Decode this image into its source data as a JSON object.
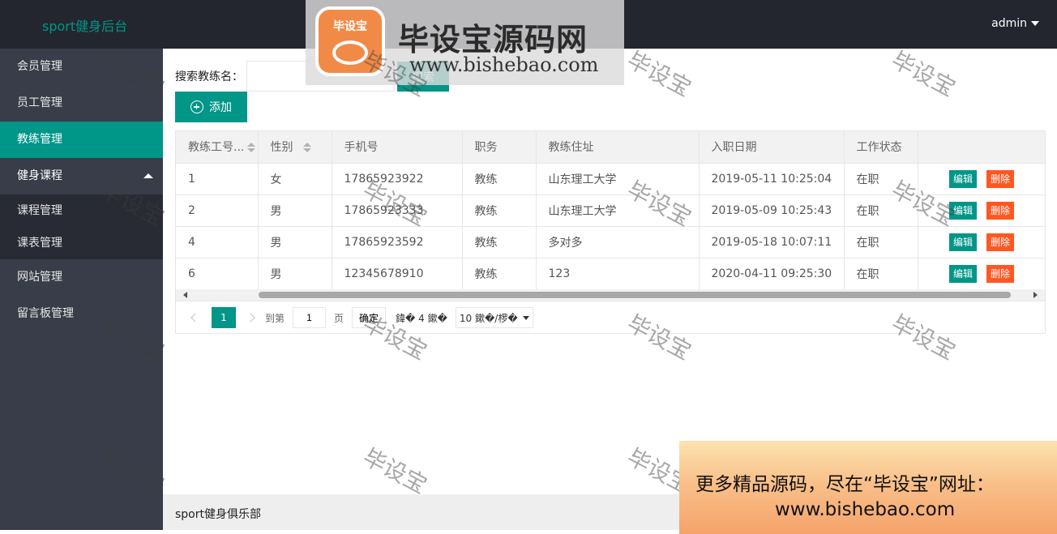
{
  "header": {
    "brand": "sport健身后台",
    "user": "admin"
  },
  "sidebar": {
    "items": [
      {
        "label": "会员管理"
      },
      {
        "label": "员工管理"
      },
      {
        "label": "教练管理",
        "active": true
      },
      {
        "label": "健身课程",
        "expanded": true,
        "children": [
          {
            "label": "课程管理"
          },
          {
            "label": "课表管理"
          }
        ]
      },
      {
        "label": "网站管理"
      },
      {
        "label": "留言板管理"
      }
    ]
  },
  "search": {
    "label": "搜索教练名：",
    "value": "",
    "button": "搜索"
  },
  "add_button": "添加",
  "table": {
    "headers": [
      "教练工号...",
      "性别",
      "手机号",
      "职务",
      "教练住址",
      "入职日期",
      "工作状态",
      ""
    ],
    "rows": [
      [
        "1",
        "女",
        "17865923922",
        "教练",
        "山东理工大学",
        "2019-05-11 10:25:04",
        "在职"
      ],
      [
        "2",
        "男",
        "17865923333",
        "教练",
        "山东理工大学",
        "2019-05-09 10:25:43",
        "在职"
      ],
      [
        "4",
        "男",
        "17865923592",
        "教练",
        "多对多",
        "2019-05-18 10:07:11",
        "在职"
      ],
      [
        "6",
        "男",
        "12345678910",
        "教练",
        "123",
        "2020-04-11 09:25:30",
        "在职"
      ]
    ],
    "edit_label": "编辑",
    "delete_label": "删除"
  },
  "pager": {
    "current": "1",
    "goto_label": "到第",
    "page_input": "1",
    "page_unit": "页",
    "confirm": "确定",
    "total": "鍏� 4 鏉�",
    "page_size": "10 鏉�/椤�"
  },
  "footer": {
    "text": "sport健身俱乐部"
  },
  "overlay": {
    "logo_badge": "毕设宝",
    "logo_title": "毕设宝源码网",
    "logo_url": "www.bishebao.com",
    "watermark": "毕设宝",
    "promo_line1": "更多精品源码，尽在“毕设宝”网址：",
    "promo_line2": "www.bishebao.com"
  },
  "colors": {
    "accent": "#009688",
    "danger": "#ff5722",
    "header_bg": "#23262e",
    "sidebar_bg": "#393d49"
  }
}
